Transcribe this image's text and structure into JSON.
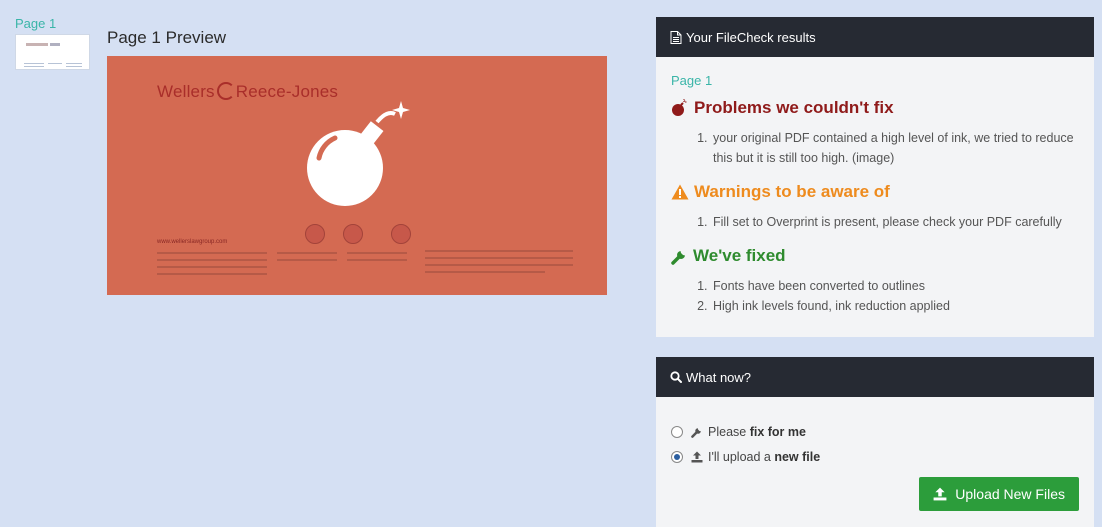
{
  "thumbnail": {
    "label": "Page 1"
  },
  "preview": {
    "title": "Page 1 Preview",
    "logo_left": "Wellers",
    "logo_right": "Reece-Jones",
    "website": "www.wellerslawgroup.com"
  },
  "results": {
    "header": "Your FileCheck results",
    "page_label": "Page 1",
    "problems": {
      "title": "Problems we couldn't fix",
      "items": [
        "your original PDF contained a high level of ink, we tried to reduce this but it is still too high. (image)"
      ]
    },
    "warnings": {
      "title": "Warnings to be aware of",
      "items": [
        "Fill set to Overprint is present, please check your PDF carefully"
      ]
    },
    "fixed": {
      "title": "We've fixed",
      "items": [
        "Fonts have been converted to outlines",
        "High ink levels found, ink reduction applied"
      ]
    }
  },
  "what_now": {
    "header": "What now?",
    "option_fix": {
      "prefix": "Please ",
      "bold": "fix for me",
      "selected": false
    },
    "option_upload": {
      "prefix": "I'll upload a ",
      "bold": "new file",
      "selected": true
    },
    "upload_button": "Upload New Files"
  },
  "colors": {
    "background": "#d5e0f3",
    "panel_header": "#262a33",
    "error": "#8f1a1a",
    "warning": "#ee8b1e",
    "success": "#2e8b2e",
    "accent": "#3ab5a8",
    "button": "#2c9d3b"
  },
  "icons": {
    "results_header": "document-icon",
    "problems": "bomb-icon",
    "warnings": "warning-icon",
    "fixed": "wrench-icon",
    "what_now_header": "search-icon",
    "upload_button": "upload-icon"
  }
}
